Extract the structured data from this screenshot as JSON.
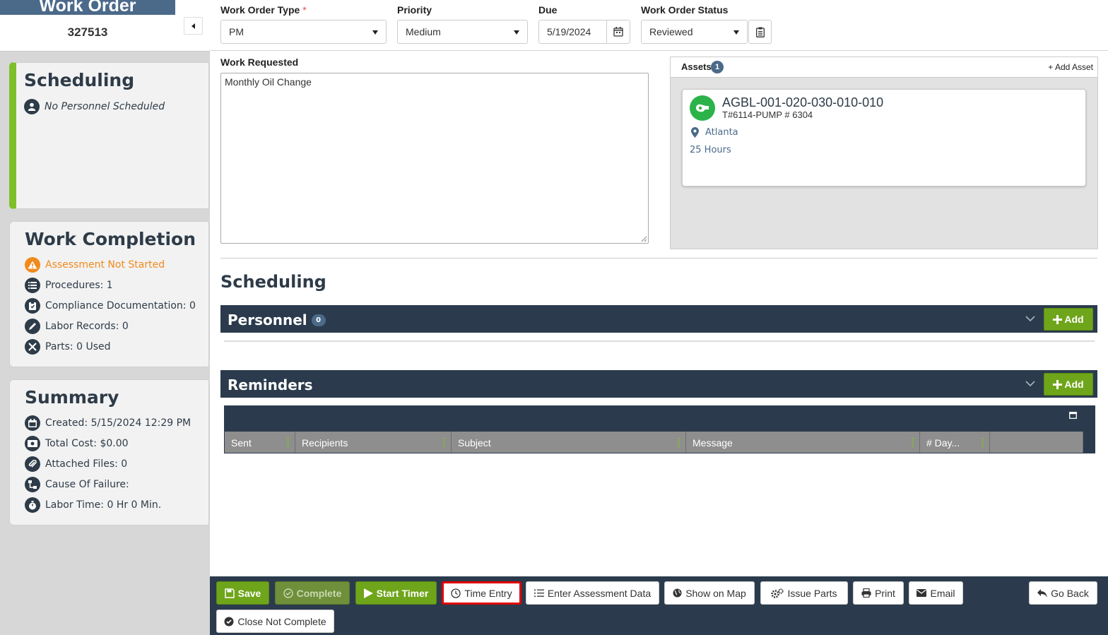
{
  "header": {
    "title": "Work Order",
    "number": "327513"
  },
  "sidebar": {
    "scheduling": {
      "title": "Scheduling",
      "personnel_text": "No Personnel Scheduled"
    },
    "work_completion": {
      "title": "Work Completion",
      "assessment": "Assessment Not Started",
      "procedures": "Procedures: 1",
      "compliance": "Compliance Documentation: 0",
      "labor": "Labor Records: 0",
      "parts": "Parts: 0 Used"
    },
    "summary": {
      "title": "Summary",
      "created": "Created: 5/15/2024 12:29 PM",
      "total_cost": "Total Cost: $0.00",
      "attached_files": "Attached Files: 0",
      "cause_of_failure": "Cause Of Failure:",
      "labor_time": "Labor Time: 0 Hr 0 Min."
    }
  },
  "form": {
    "type": {
      "label": "Work Order Type",
      "required": "*",
      "value": "PM"
    },
    "priority": {
      "label": "Priority",
      "value": "Medium"
    },
    "due": {
      "label": "Due",
      "value": "5/19/2024"
    },
    "status": {
      "label": "Work Order Status",
      "value": "Reviewed"
    },
    "work_requested": {
      "label": "Work Requested",
      "value": "Monthly Oil Change"
    }
  },
  "assets": {
    "label": "Assets",
    "count": "1",
    "add_label": "+ Add Asset",
    "items": [
      {
        "code": "AGBL-001-020-030-010-010",
        "name": "T#6114-PUMP # 6304",
        "location": "Atlanta",
        "hours": "25 Hours"
      }
    ]
  },
  "scheduling": {
    "title": "Scheduling",
    "personnel": {
      "title": "Personnel",
      "count": "0",
      "add_label": "Add"
    },
    "reminders": {
      "title": "Reminders",
      "add_label": "Add",
      "columns": [
        "Sent",
        "Recipients",
        "Subject",
        "Message",
        "# Day..."
      ]
    }
  },
  "toolbar": {
    "save": "Save",
    "complete": "Complete",
    "start_timer": "Start Timer",
    "time_entry": "Time Entry",
    "assessment": "Enter Assessment Data",
    "show_map": "Show on Map",
    "issue_parts": "Issue Parts",
    "print": "Print",
    "email": "Email",
    "go_back": "Go Back",
    "close_not_complete": "Close Not Complete"
  },
  "colors": {
    "accent_green": "#6fa51a",
    "dark_navy": "#2b3b4d",
    "warning_orange": "#f08a1c",
    "header_blue": "#4b6a8a",
    "highlight_red": "#e00000"
  }
}
